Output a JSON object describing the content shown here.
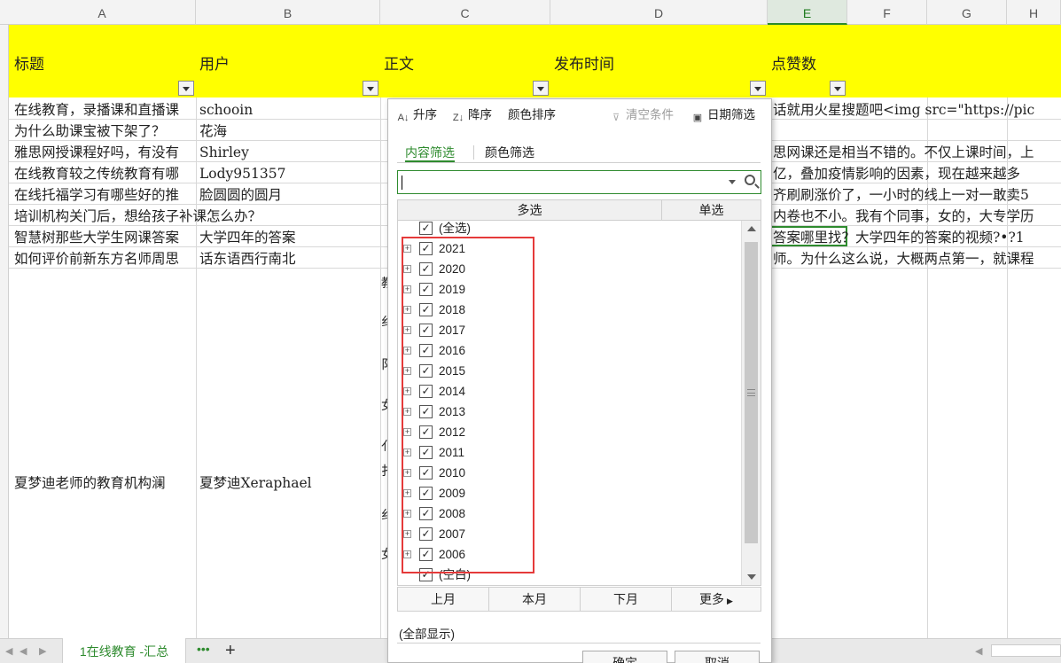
{
  "columns": [
    "A",
    "B",
    "C",
    "D",
    "E",
    "F",
    "G",
    "H"
  ],
  "header_row": {
    "labels": [
      "标题",
      "用户",
      "正文",
      "发布时间",
      "点赞数"
    ]
  },
  "rows": [
    {
      "title": "在线教育，录播课和直播课",
      "user": "schooin",
      "right": "话就用火星搜题吧<img src=\"https://pic"
    },
    {
      "title": "为什么助课宝被下架了？",
      "user": "花海",
      "right": ""
    },
    {
      "title": "雅思网授课程好吗，有没有",
      "user": "Shirley",
      "right": "思网课还是相当不错的。不仅上课时间，上"
    },
    {
      "title": "在线教育较之传统教育有哪",
      "user": "Lody951357",
      "right": "亿，叠加疫情影响的因素，现在越来越多"
    },
    {
      "title": "在线托福学习有哪些好的推",
      "user": "脸圆圆的圆月",
      "right": "齐刷刷涨价了，一小时的线上一对一敢卖5"
    },
    {
      "title": "培训机构关门后，想给孩子补课怎么办？",
      "user": "",
      "right": "内卷也不小。我有个同事，女的，大专学历"
    },
    {
      "title": "智慧树那些大学生网课答案",
      "user": "大学四年的答案",
      "right": "答案哪里找？大学四年的答案的视频?•?1"
    },
    {
      "title": "如何评价前新东方名师周思",
      "user": "话东语西行南北",
      "right": "师。为什么这么说，大概两点第一，就课程"
    }
  ],
  "big_row": {
    "title": "夏梦迪老师的教育机构澜",
    "user": "夏梦迪Xeraphael"
  },
  "col_c_fragments": [
    "教",
    "纟",
    "阝",
    "女",
    "亻",
    "扌",
    "纟",
    "女"
  ],
  "sheet": {
    "tab_label": "1在线教育 -汇总",
    "more": "•••",
    "add": "+"
  },
  "filter_popup": {
    "toolbar": {
      "asc": "升序",
      "desc": "降序",
      "color_sort": "颜色排序",
      "clear": "清空条件",
      "date_filter": "日期筛选"
    },
    "tabs": {
      "content": "内容筛选",
      "color": "颜色筛选"
    },
    "search_placeholder": "",
    "list_header": {
      "multi": "多选",
      "single": "单选"
    },
    "select_all": "(全选)",
    "years": [
      "2021",
      "2020",
      "2019",
      "2018",
      "2017",
      "2016",
      "2015",
      "2014",
      "2013",
      "2012",
      "2011",
      "2010",
      "2009",
      "2008",
      "2007",
      "2006"
    ],
    "blank": "(空白)",
    "month_buttons": {
      "last": "上月",
      "this": "本月",
      "next": "下月",
      "more": "更多"
    },
    "show_all": "(全部显示)",
    "ok": "确定",
    "cancel": "取消"
  },
  "colors": {
    "header_fill": "#ffff00",
    "accent_green": "#2e8b2e",
    "highlight_red": "#e53a3a"
  }
}
